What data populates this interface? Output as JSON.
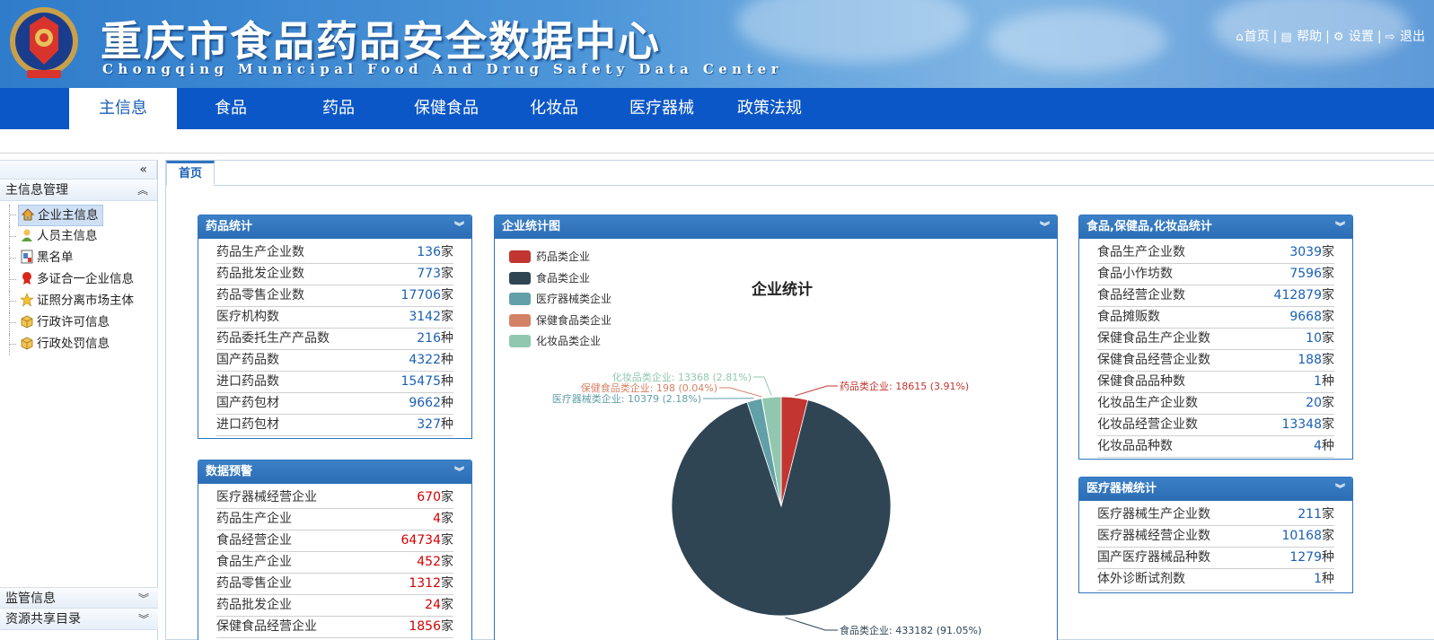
{
  "header": {
    "title": "重庆市食品药品安全数据中心",
    "subtitle": "Chongqing Municipal Food And Drug Safety Data Center",
    "links": [
      {
        "icon": "home-icon",
        "label": "首页"
      },
      {
        "icon": "book-icon",
        "label": "帮助"
      },
      {
        "icon": "gear-icon",
        "label": "设置"
      },
      {
        "icon": "signout-icon",
        "label": "退出"
      }
    ]
  },
  "nav": {
    "items": [
      "主信息",
      "食品",
      "药品",
      "保健食品",
      "化妆品",
      "医疗器械",
      "政策法规"
    ],
    "active": "主信息"
  },
  "sidebar": {
    "collapse": "«",
    "groups": [
      {
        "title": "主信息管理",
        "expanded_icon": "«",
        "items": [
          {
            "label": "企业主信息",
            "icon": "house-icon",
            "selected": true
          },
          {
            "label": "人员主信息",
            "icon": "user-icon"
          },
          {
            "label": "黑名单",
            "icon": "blacklist-icon"
          },
          {
            "label": "多证合一企业信息",
            "icon": "ribbon-icon"
          },
          {
            "label": "证照分离市场主体",
            "icon": "star-icon"
          },
          {
            "label": "行政许可信息",
            "icon": "box-icon"
          },
          {
            "label": "行政处罚信息",
            "icon": "box-icon"
          }
        ]
      },
      {
        "title": "监管信息",
        "collapsed_icon": "»"
      },
      {
        "title": "资源共享目录",
        "collapsed_icon": "»"
      }
    ]
  },
  "tabs": [
    "首页"
  ],
  "drug_stats": {
    "title": "药品统计",
    "rows": [
      {
        "label": "药品生产企业数",
        "value": "136",
        "unit": "家"
      },
      {
        "label": "药品批发企业数",
        "value": "773",
        "unit": "家"
      },
      {
        "label": "药品零售企业数",
        "value": "17706",
        "unit": "家"
      },
      {
        "label": "医疗机构数",
        "value": "3142",
        "unit": "家"
      },
      {
        "label": "药品委托生产产品数",
        "value": "216",
        "unit": "种"
      },
      {
        "label": "国产药品数",
        "value": "4322",
        "unit": "种"
      },
      {
        "label": "进口药品数",
        "value": "15475",
        "unit": "种"
      },
      {
        "label": "国产药包材",
        "value": "9662",
        "unit": "种"
      },
      {
        "label": "进口药包材",
        "value": "327",
        "unit": "种"
      }
    ]
  },
  "data_warning": {
    "title": "数据预警",
    "rows": [
      {
        "label": "医疗器械经营企业",
        "value": "670",
        "unit": "家"
      },
      {
        "label": "药品生产企业",
        "value": "4",
        "unit": "家"
      },
      {
        "label": "食品经营企业",
        "value": "64734",
        "unit": "家"
      },
      {
        "label": "食品生产企业",
        "value": "452",
        "unit": "家"
      },
      {
        "label": "药品零售企业",
        "value": "1312",
        "unit": "家"
      },
      {
        "label": "药品批发企业",
        "value": "24",
        "unit": "家"
      },
      {
        "label": "保健食品经营企业",
        "value": "1856",
        "unit": "家"
      }
    ]
  },
  "chart_panel": {
    "title": "企业统计图"
  },
  "chart_data": {
    "type": "pie",
    "title": "企业统计",
    "legend_placement": "top-left",
    "series": [
      {
        "name": "药品类企业",
        "value": 18615,
        "percent": "3.91%",
        "color": "#c23531"
      },
      {
        "name": "食品类企业",
        "value": 433182,
        "percent": "91.05%",
        "color": "#2f4554"
      },
      {
        "name": "医疗器械类企业",
        "value": 10379,
        "percent": "2.18%",
        "color": "#61a0a8"
      },
      {
        "name": "保健食品类企业",
        "value": 198,
        "percent": "0.04%",
        "color": "#d48265"
      },
      {
        "name": "化妆品类企业",
        "value": 13368,
        "percent": "2.81%",
        "color": "#91c7ae"
      }
    ]
  },
  "food_stats": {
    "title": "食品,保健品,化妆品统计",
    "rows": [
      {
        "label": "食品生产企业数",
        "value": "3039",
        "unit": "家"
      },
      {
        "label": "食品小作坊数",
        "value": "7596",
        "unit": "家"
      },
      {
        "label": "食品经营企业数",
        "value": "412879",
        "unit": "家"
      },
      {
        "label": "食品摊贩数",
        "value": "9668",
        "unit": "家"
      },
      {
        "label": "保健食品生产企业数",
        "value": "10",
        "unit": "家"
      },
      {
        "label": "保健食品经营企业数",
        "value": "188",
        "unit": "家"
      },
      {
        "label": "保健食品品种数",
        "value": "1",
        "unit": "种"
      },
      {
        "label": "化妆品生产企业数",
        "value": "20",
        "unit": "家"
      },
      {
        "label": "化妆品经营企业数",
        "value": "13348",
        "unit": "家"
      },
      {
        "label": "化妆品品种数",
        "value": "4",
        "unit": "种"
      }
    ]
  },
  "device_stats": {
    "title": "医疗器械统计",
    "rows": [
      {
        "label": "医疗器械生产企业数",
        "value": "211",
        "unit": "家"
      },
      {
        "label": "医疗器械经营企业数",
        "value": "10168",
        "unit": "家"
      },
      {
        "label": "国产医疗器械品种数",
        "value": "1279",
        "unit": "种"
      },
      {
        "label": "体外诊断试剂数",
        "value": "1",
        "unit": "种"
      }
    ]
  },
  "colors": {
    "nav_bg": "#0c57c7",
    "panel_head": "#2f74c0",
    "value_blue": "#1a5fb4",
    "value_red": "#d40000"
  }
}
